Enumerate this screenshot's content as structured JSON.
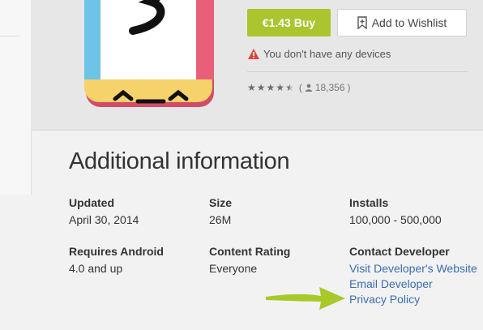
{
  "header": {
    "buy_label": "€1.43 Buy",
    "wishlist_label": "Add to Wishlist",
    "warning_text": "You don't have any devices",
    "rating_count": "18,356",
    "rating_stars": 4.5,
    "accent_green": "#aac52e"
  },
  "additional_info": {
    "title": "Additional information",
    "updated": {
      "label": "Updated",
      "value": "April 30, 2014"
    },
    "size": {
      "label": "Size",
      "value": "26M"
    },
    "installs": {
      "label": "Installs",
      "value": "100,000 - 500,000"
    },
    "requires_android": {
      "label": "Requires Android",
      "value": "4.0 and up"
    },
    "content_rating": {
      "label": "Content Rating",
      "value": "Everyone"
    },
    "contact_developer": {
      "label": "Contact Developer",
      "links": [
        "Visit Developer's Website",
        "Email Developer",
        "Privacy Policy"
      ]
    },
    "link_color": "#3a6db5"
  },
  "icons": {
    "wishlist": "bookmark-plus-icon",
    "warning": "warning-icon",
    "person": "person-icon",
    "arrow": "green-arrow-icon"
  }
}
